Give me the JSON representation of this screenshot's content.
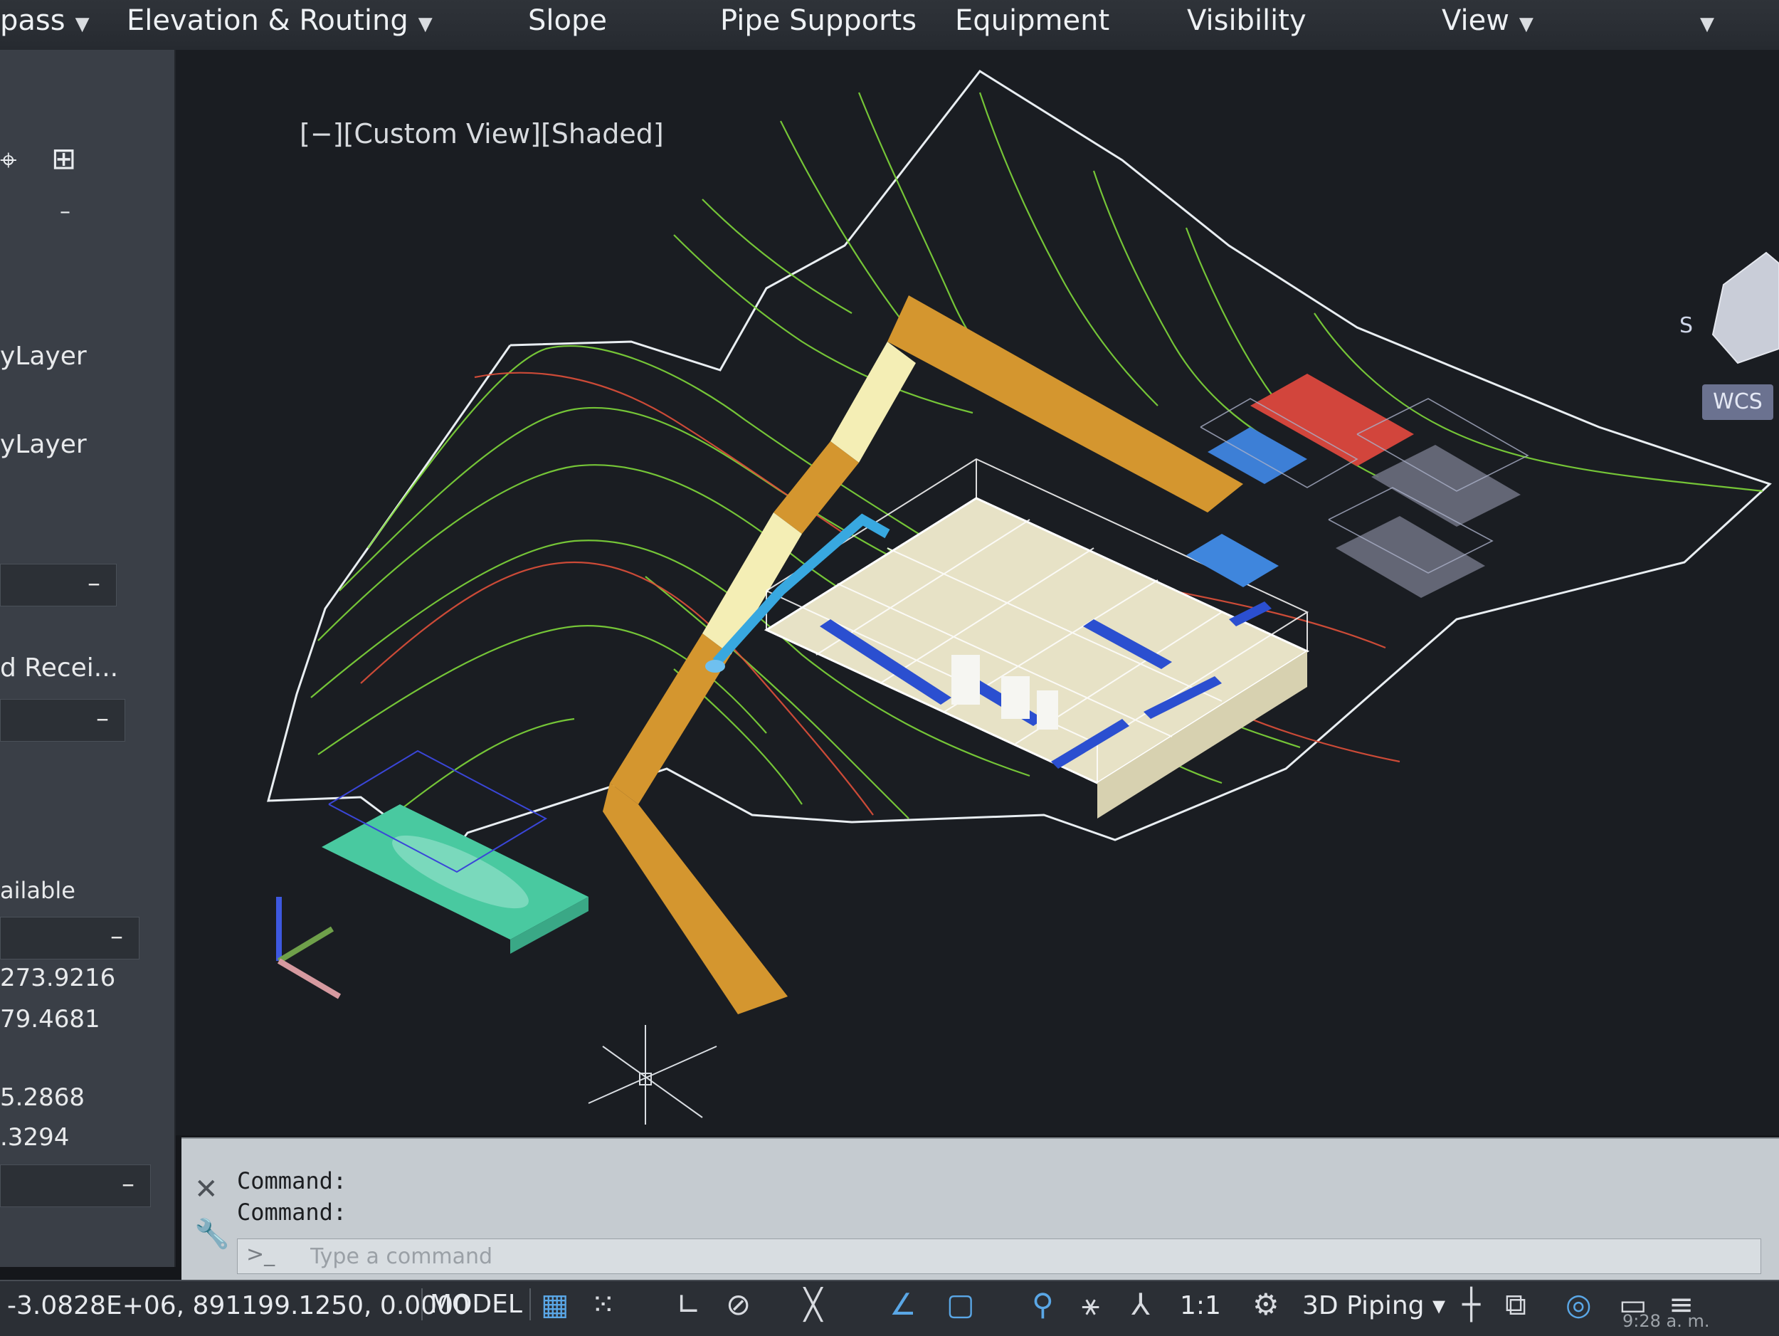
{
  "ribbon": {
    "items": [
      "pass",
      "Elevation & Routing",
      "Slope",
      "Pipe Supports",
      "Equipment",
      "Visibility",
      "View"
    ]
  },
  "viewport": {
    "label": "[−][Custom View][Shaded]",
    "wcs": "WCS",
    "compass_s": "S"
  },
  "palette": {
    "layer1": "yLayer",
    "layer2": "yLayer",
    "received": "d  Recei...",
    "available": "ailable",
    "val1": "273.9216",
    "val2": "79.4681",
    "val3": "5.2868",
    "val4": ".3294",
    "minus": "–"
  },
  "command": {
    "line1": "Command:",
    "line2": "Command:",
    "prompt": ">_",
    "placeholder": "Type a command"
  },
  "status": {
    "coords": "-3.0828E+06, 891199.1250, 0.0000",
    "model": "MODEL",
    "scale": "1:1",
    "workspace": "3D Piping",
    "time": "9:28 a. m."
  },
  "colors": {
    "contour_green": "#7fd83a",
    "contour_red": "#e0503a",
    "boundary": "#e9eef2",
    "road": "#d4962f",
    "road_light": "#f4eeb5",
    "building_floor": "#e7e2c6",
    "equipment_blue": "#2b4fd0",
    "pipe_cyan": "#38a8e0",
    "tank_green": "#49c9a0",
    "roof_red": "#d2453c"
  }
}
